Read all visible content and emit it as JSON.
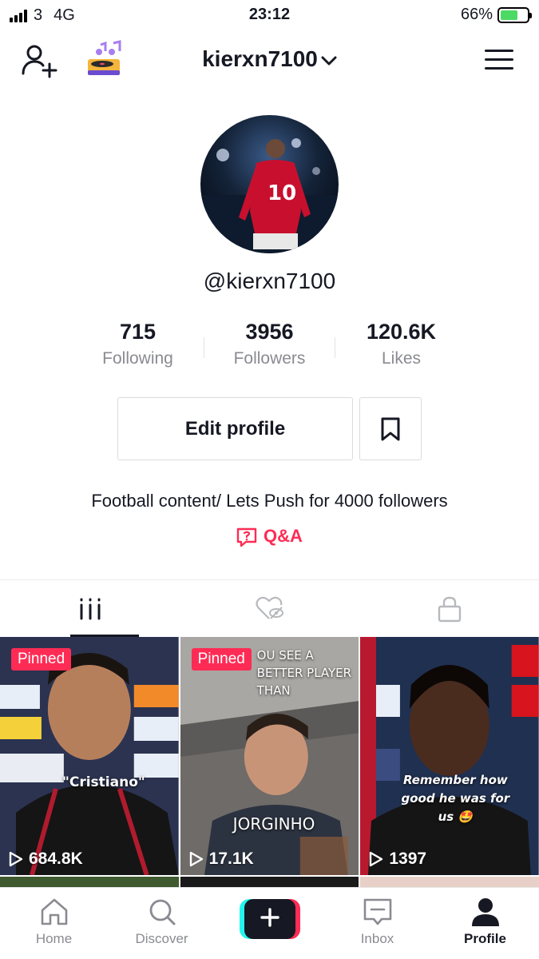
{
  "status_bar": {
    "carrier": "3",
    "network": "4G",
    "time": "23:12",
    "battery": "66%",
    "battery_level": 0.66
  },
  "header": {
    "username": "kierxn7100"
  },
  "profile": {
    "handle": "@kierxn7100",
    "stats": [
      {
        "value": "715",
        "label": "Following"
      },
      {
        "value": "3956",
        "label": "Followers"
      },
      {
        "value": "120.6K",
        "label": "Likes"
      }
    ],
    "edit_label": "Edit profile",
    "bio": "Football content/ Lets Push for 4000 followers",
    "qa_label": "Q&A"
  },
  "tabs": [
    "videos-icon",
    "liked-hidden-icon",
    "lock-icon"
  ],
  "videos": [
    {
      "pinned": "Pinned",
      "views": "684.8K",
      "caption": "\"Cristiano\""
    },
    {
      "pinned": "Pinned",
      "views": "17.1K",
      "caption_top": "OU SEE A BETTER PLAYER THAN",
      "caption": "JORGINHO"
    },
    {
      "views": "1397",
      "caption": "Remember how good he was for us 🤩"
    }
  ],
  "bottom_nav": [
    {
      "label": "Home",
      "icon": "home-icon"
    },
    {
      "label": "Discover",
      "icon": "search-icon"
    },
    {
      "label": "",
      "icon": "plus-icon"
    },
    {
      "label": "Inbox",
      "icon": "inbox-icon"
    },
    {
      "label": "Profile",
      "icon": "profile-icon"
    }
  ],
  "colors": {
    "accent": "#fe2c55",
    "text": "#161823",
    "muted": "#8a8b91",
    "tiktok_cyan": "#25f4ee"
  }
}
